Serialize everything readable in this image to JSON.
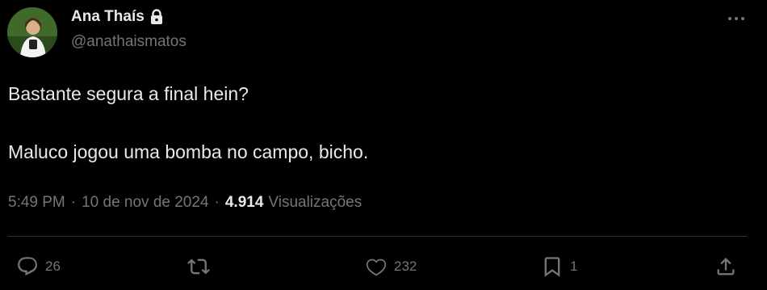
{
  "author": {
    "display_name": "Ana Thaís",
    "handle": "@anathaismatos",
    "protected": true
  },
  "tweet": {
    "lines": [
      "Bastante segura a final hein?",
      "Maluco jogou uma bomba no campo, bicho."
    ]
  },
  "meta": {
    "time": "5:49 PM",
    "separator": "·",
    "date": "10 de nov de 2024",
    "views_count": "4.914",
    "views_label": "Visualizações"
  },
  "actions": {
    "replies": "26",
    "retweets": "",
    "likes": "232",
    "bookmarks": "1"
  },
  "icons": {
    "lock": "lock-icon",
    "more": "more-horizontal-icon",
    "reply": "reply-icon",
    "retweet": "retweet-icon",
    "like": "heart-icon",
    "bookmark": "bookmark-icon",
    "share": "share-icon"
  },
  "colors": {
    "background": "#000000",
    "primary_text": "#e7e9ea",
    "secondary_text": "#71767b",
    "divider": "#2f3336"
  }
}
